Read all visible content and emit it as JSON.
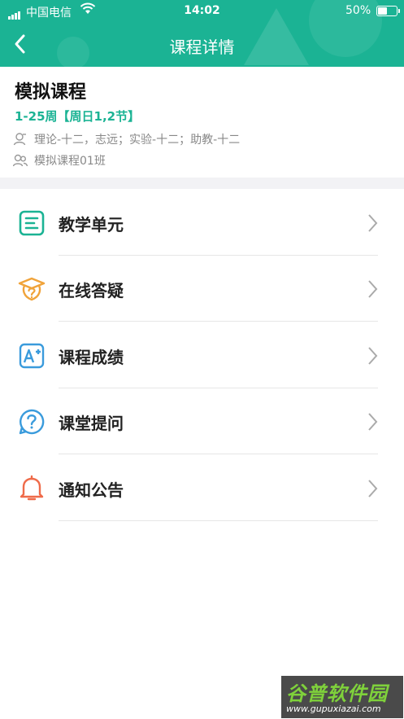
{
  "status_bar": {
    "carrier": "中国电信",
    "time": "14:02",
    "battery": "50%"
  },
  "nav": {
    "title": "课程详情"
  },
  "course": {
    "name": "模拟课程",
    "weeks": "1-25周【周日1,2节】",
    "teachers": "理论-十二，志远；实验-十二；助教-十二",
    "class_name": "模拟课程01班"
  },
  "menu": [
    {
      "label": "教学单元",
      "icon": "list-icon",
      "color": "#1bb394"
    },
    {
      "label": "在线答疑",
      "icon": "graduation-question-icon",
      "color": "#f0a33a"
    },
    {
      "label": "课程成绩",
      "icon": "grade-a-plus-icon",
      "color": "#3a9bdc"
    },
    {
      "label": "课堂提问",
      "icon": "question-circle-icon",
      "color": "#3a9bdc"
    },
    {
      "label": "通知公告",
      "icon": "bell-icon",
      "color": "#ef6b4a"
    }
  ],
  "watermark": {
    "title": "谷普软件园",
    "url": "www.gupuxiazai.com"
  }
}
